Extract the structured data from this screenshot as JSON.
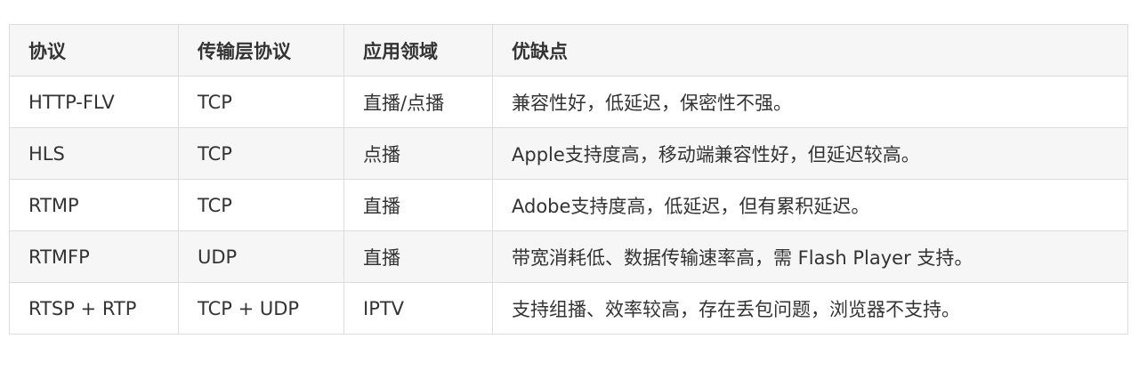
{
  "table": {
    "headers": [
      "协议",
      "传输层协议",
      "应用领域",
      "优缺点"
    ],
    "rows": [
      [
        "HTTP-FLV",
        "TCP",
        "直播/点播",
        "兼容性好，低延迟，保密性不强。"
      ],
      [
        "HLS",
        "TCP",
        "点播",
        "Apple支持度高，移动端兼容性好，但延迟较高。"
      ],
      [
        "RTMP",
        "TCP",
        "直播",
        "Adobe支持度高，低延迟，但有累积延迟。"
      ],
      [
        "RTMFP",
        "UDP",
        "直播",
        "带宽消耗低、数据传输速率高，需 Flash Player 支持。"
      ],
      [
        "RTSP + RTP",
        "TCP + UDP",
        "IPTV",
        "支持组播、效率较高，存在丢包问题，浏览器不支持。"
      ]
    ]
  },
  "colors": {
    "header_bg": "#f6f6f6",
    "stripe_bg": "#f6f6f6",
    "border": "#dddddd",
    "text": "#333333"
  }
}
